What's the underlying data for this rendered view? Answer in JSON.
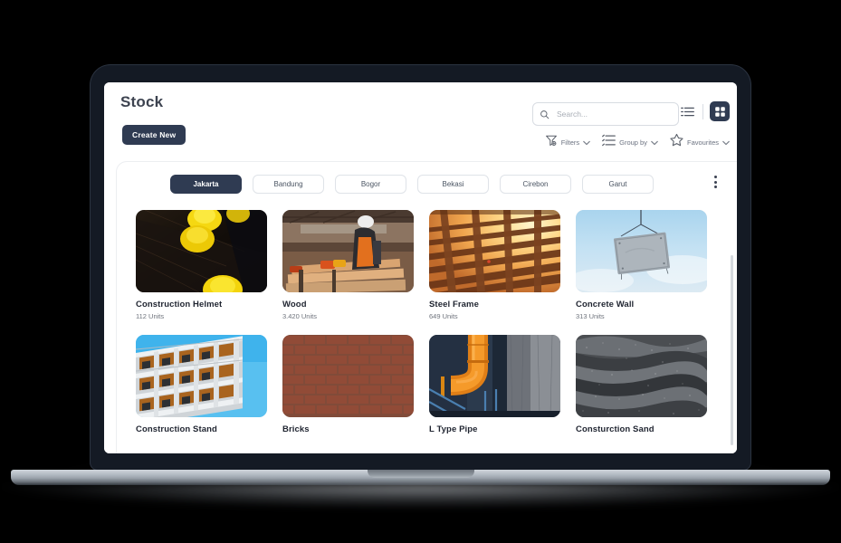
{
  "header": {
    "title": "Stock",
    "create_label": "Create New"
  },
  "search": {
    "placeholder": "Search...",
    "value": "",
    "icon": "search-icon"
  },
  "view_toggle": {
    "list_icon": "list-view-icon",
    "grid_icon": "grid-view-icon",
    "active": "grid"
  },
  "filters": [
    {
      "label": "Filters",
      "icon": "funnel-icon",
      "chevron": "chevron-down-icon"
    },
    {
      "label": "Group by",
      "icon": "sort-lines-icon",
      "chevron": "chevron-down-icon"
    },
    {
      "label": "Favourites",
      "icon": "star-icon",
      "chevron": "chevron-down-icon"
    }
  ],
  "tabs": [
    {
      "label": "Jakarta",
      "active": true
    },
    {
      "label": "Bandung",
      "active": false
    },
    {
      "label": "Bogor",
      "active": false
    },
    {
      "label": "Bekasi",
      "active": false
    },
    {
      "label": "Cirebon",
      "active": false
    },
    {
      "label": "Garut",
      "active": false
    }
  ],
  "overflow_menu_icon": "kebab-menu-icon",
  "cards": [
    {
      "title": "Construction Helmet",
      "units": "112 Units",
      "image": "yellow-hard-hats-on-dark-wood"
    },
    {
      "title": "Wood",
      "units": "3.420 Units",
      "image": "worker-cutting-lumber-in-workshop"
    },
    {
      "title": "Steel Frame",
      "units": "649 Units",
      "image": "steel-roof-frame-at-sunset"
    },
    {
      "title": "Concrete Wall",
      "units": "313 Units",
      "image": "concrete-slab-hanging-from-crane"
    },
    {
      "title": "Construction Stand",
      "units": "",
      "image": "building-scaffolding-against-blue-sky"
    },
    {
      "title": "Bricks",
      "units": "",
      "image": "red-brick-wall"
    },
    {
      "title": "L Type Pipe",
      "units": "",
      "image": "orange-l-shaped-pipe"
    },
    {
      "title": "Consturction Sand",
      "units": "",
      "image": "gray-rippled-sand"
    }
  ],
  "colors": {
    "accent_navy": "#2f3b52",
    "text_dark": "#1f2430",
    "text_muted": "#6e737c",
    "border": "#dfe3e8",
    "laptop_body": "#141a24"
  }
}
